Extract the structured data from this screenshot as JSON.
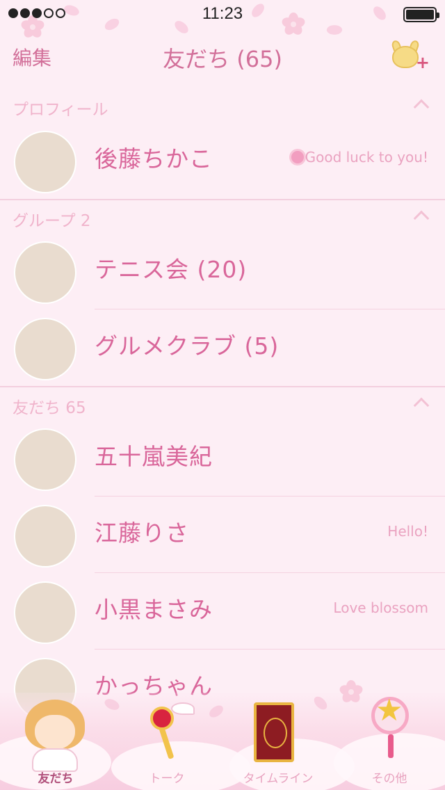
{
  "status_bar": {
    "time": "11:23",
    "signal_bars_filled": 3,
    "signal_bars_total": 5
  },
  "nav": {
    "edit_label": "編集",
    "title": "友だち (65)",
    "add_friend_icon": "add-friend-icon"
  },
  "sections": {
    "profile": {
      "label": "プロフィール",
      "user": {
        "name": "後藤ちかこ",
        "status": "Good luck to you!"
      }
    },
    "groups": {
      "label": "グループ 2",
      "items": [
        {
          "name": "テニス会 (20)"
        },
        {
          "name": "グルメクラブ (5)"
        }
      ]
    },
    "friends": {
      "label": "友だち 65",
      "items": [
        {
          "name": "五十嵐美紀",
          "status": ""
        },
        {
          "name": "江藤りさ",
          "status": "Hello!"
        },
        {
          "name": "小黒まさみ",
          "status": "Love blossom"
        },
        {
          "name": "かっちゃん",
          "status": ""
        }
      ]
    }
  },
  "tabbar": {
    "tabs": [
      {
        "label": "友だち",
        "active": true
      },
      {
        "label": "トーク",
        "active": false
      },
      {
        "label": "タイムライン",
        "active": false
      },
      {
        "label": "その他",
        "active": false
      }
    ]
  },
  "colors": {
    "background": "#fdeef5",
    "accent_text": "#d9669a",
    "section_text": "#f0b3cb",
    "status_text": "#eaa2c0"
  }
}
